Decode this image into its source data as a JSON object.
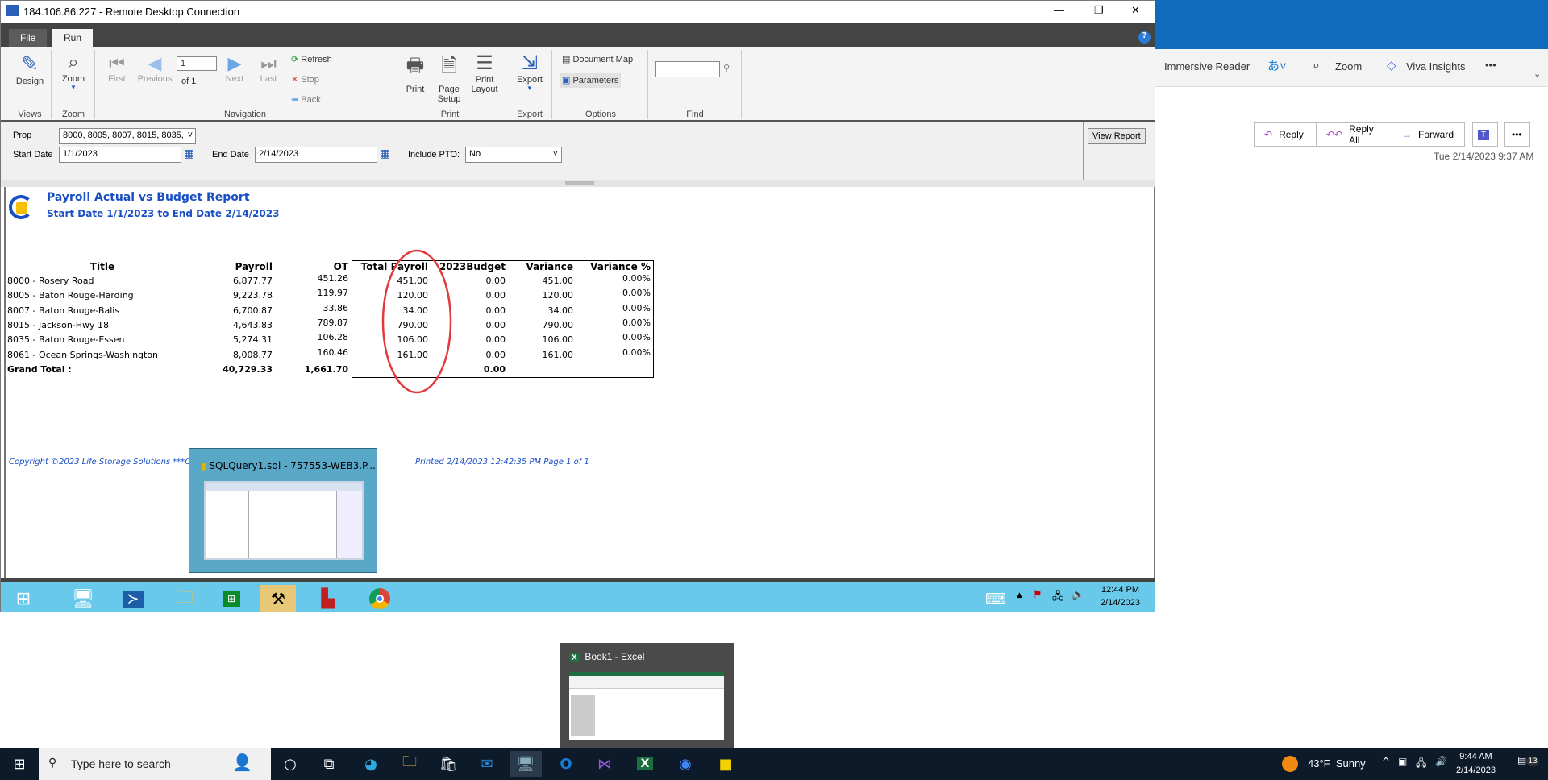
{
  "rdp_window": {
    "title": "184.106.86.227 - Remote Desktop Connection",
    "controls": {
      "minimize": "—",
      "restore": "❐",
      "close": "✕"
    }
  },
  "report_viewer": {
    "tabs": [
      {
        "label": "File"
      },
      {
        "label": "Run",
        "active": true
      }
    ],
    "help": "?",
    "ribbon": {
      "views": {
        "design": "Design",
        "group": "Views"
      },
      "zoom": {
        "zoom": "Zoom",
        "group": "Zoom"
      },
      "navigation": {
        "first": "First",
        "previous": "Previous",
        "page": "1",
        "of": "of 1",
        "next": "Next",
        "last": "Last",
        "refresh": "Refresh",
        "stop": "Stop",
        "back": "Back",
        "group": "Navigation"
      },
      "print": {
        "print": "Print",
        "page_setup_1": "Page",
        "page_setup_2": "Setup",
        "print_layout_1": "Print",
        "print_layout_2": "Layout",
        "group": "Print"
      },
      "export": {
        "export": "Export",
        "group": "Export"
      },
      "options": {
        "document_map": "Document Map",
        "parameters": "Parameters",
        "group": "Options"
      },
      "find": {
        "value": "",
        "group": "Find"
      }
    },
    "params": {
      "prop_label": "Prop",
      "prop_value": "8000, 8005, 8007, 8015, 8035,",
      "start_label": "Start Date",
      "start_value": "1/1/2023",
      "end_label": "End Date",
      "end_value": "2/14/2023",
      "pto_label": "Include PTO:",
      "pto_value": "No",
      "view_report": "View Report"
    },
    "report": {
      "title": "Payroll Actual vs Budget Report",
      "subtitle": "Start Date  1/1/2023 to End Date 2/14/2023",
      "columns": [
        "Title",
        "Payroll",
        "OT",
        "Total Payroll",
        "2023Budget",
        "Variance",
        "Variance %"
      ],
      "rows": [
        [
          "8000 - Rosery Road",
          "6,877.77",
          "451.26",
          "451.00",
          "0.00",
          "451.00",
          "0.00%"
        ],
        [
          "8005 - Baton Rouge-Harding",
          "9,223.78",
          "119.97",
          "120.00",
          "0.00",
          "120.00",
          "0.00%"
        ],
        [
          "8007 - Baton Rouge-Balis",
          "6,700.87",
          "33.86",
          "34.00",
          "0.00",
          "34.00",
          "0.00%"
        ],
        [
          "8015 - Jackson-Hwy 18",
          "4,643.83",
          "789.87",
          "790.00",
          "0.00",
          "790.00",
          "0.00%"
        ],
        [
          "8035 - Baton Rouge-Essen",
          "5,274.31",
          "106.28",
          "106.00",
          "0.00",
          "106.00",
          "0.00%"
        ],
        [
          "8061 - Ocean Springs-Washington",
          "8,008.77",
          "160.46",
          "161.00",
          "0.00",
          "161.00",
          "0.00%"
        ]
      ],
      "total": {
        "label": "Grand Total :",
        "payroll": "40,729.33",
        "ot": "1,661.70",
        "budget": "0.00"
      },
      "footer_left": "Copyright ©2023 Life Storage Solutions   ***Co",
      "footer_right": "Printed 2/14/2023 12:42:35 PM Page 1 of 1",
      "annotation_color": "#e0393e"
    },
    "sql_preview": {
      "title": "SQLQuery1.sql - 757553-WEB3.P..."
    },
    "remote_taskbar": {
      "time": "12:44 PM",
      "date": "2/14/2023"
    }
  },
  "outlook": {
    "toolbar": {
      "immersive_reader": "Immersive Reader",
      "zoom": "Zoom",
      "viva": "Viva Insights",
      "more": "•••"
    },
    "actions": {
      "reply": "Reply",
      "reply_all": "Reply All",
      "forward": "Forward",
      "more": "•••"
    },
    "timestamp": "Tue 2/14/2023 9:37 AM"
  },
  "excel_preview": {
    "title": "Book1 - Excel"
  },
  "windows_taskbar": {
    "search_placeholder": "Type here to search",
    "weather": "43°F  Sunny",
    "time": "9:44 AM",
    "date": "2/14/2023",
    "notifications": "13"
  },
  "colors": {
    "report_blue": "#1a4fc4",
    "ribbon_bg": "#f4f4f4",
    "remote_taskbar": "#69c9ea",
    "outlook_blue": "#0f6cbd"
  }
}
